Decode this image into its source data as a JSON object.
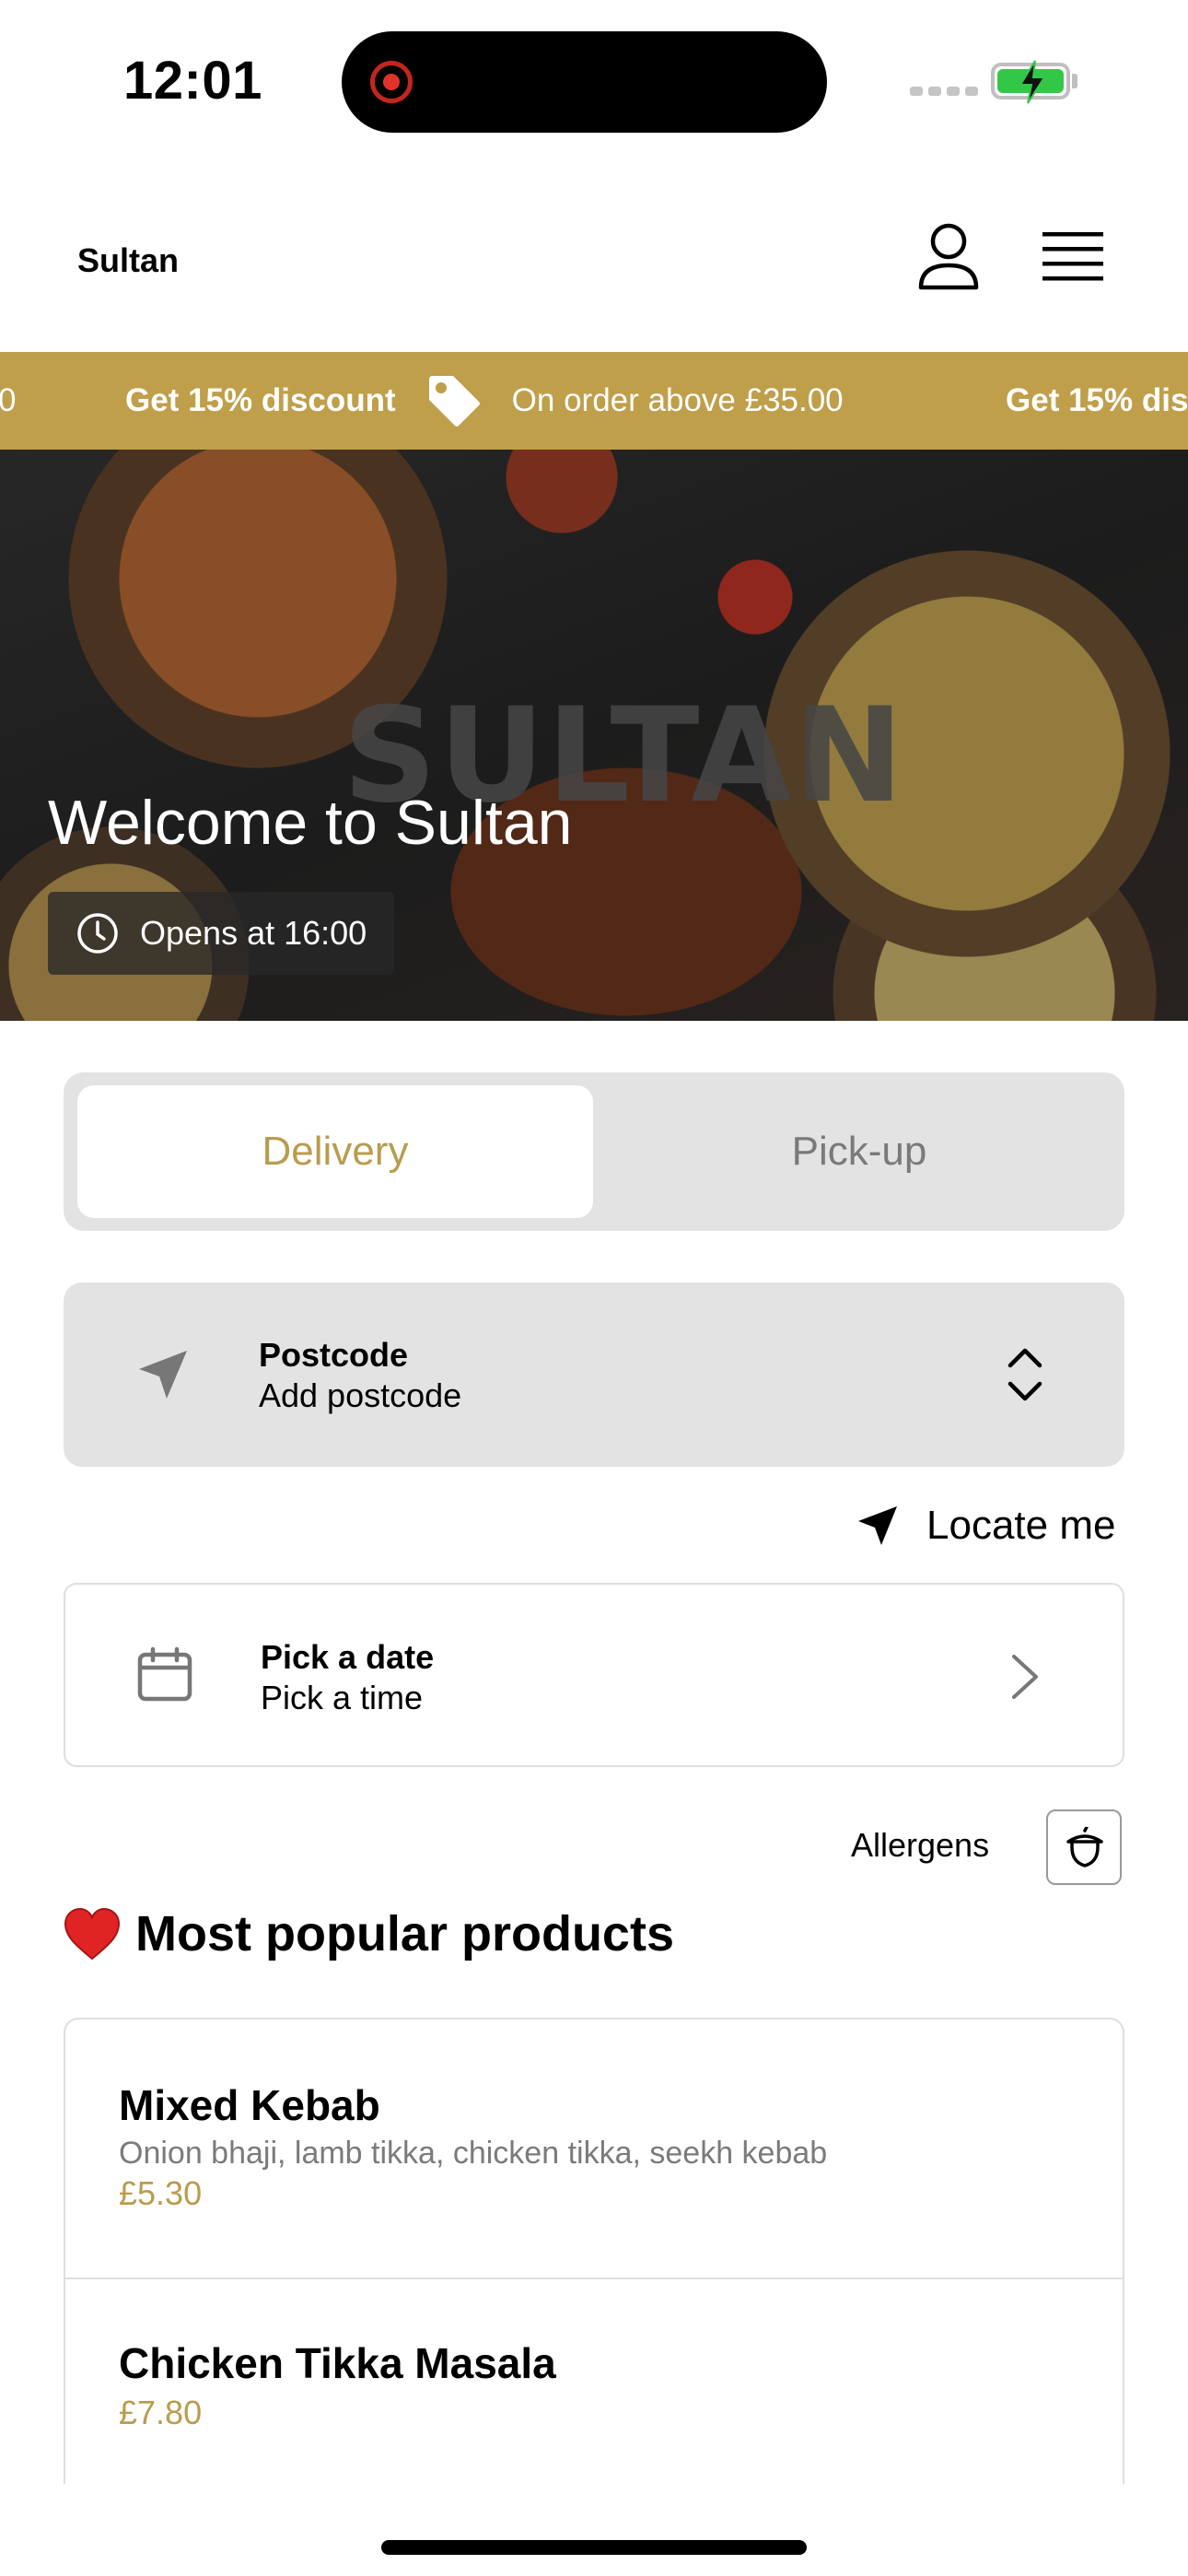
{
  "status_bar": {
    "time": "12:01"
  },
  "header": {
    "brand": "Sultan"
  },
  "promo": {
    "items": [
      {
        "strong": "Get 15% discount",
        "light": "On order above £35.00"
      }
    ],
    "left_fragment": "0",
    "right_fragment": "Get 15% dis"
  },
  "hero": {
    "logo_text": "SULTAN",
    "title": "Welcome to Sultan",
    "opens": "Opens at 16:00"
  },
  "order_mode": {
    "options": [
      "Delivery",
      "Pick-up"
    ],
    "selected": "Delivery"
  },
  "postcode": {
    "label": "Postcode",
    "value": "Add postcode"
  },
  "locate": {
    "label": "Locate me"
  },
  "schedule": {
    "date_label": "Pick a date",
    "time_label": "Pick a time"
  },
  "allergens": {
    "label": "Allergens"
  },
  "popular": {
    "title": "Most popular products",
    "products": [
      {
        "name": "Mixed Kebab",
        "description": "Onion bhaji, lamb tikka, chicken tikka, seekh kebab",
        "price": "£5.30"
      },
      {
        "name": "Chicken Tikka Masala",
        "price": "£7.80"
      }
    ]
  },
  "colors": {
    "accent": "#bf9f4a",
    "price": "#b99c4e",
    "panel": "#e3e3e3"
  }
}
